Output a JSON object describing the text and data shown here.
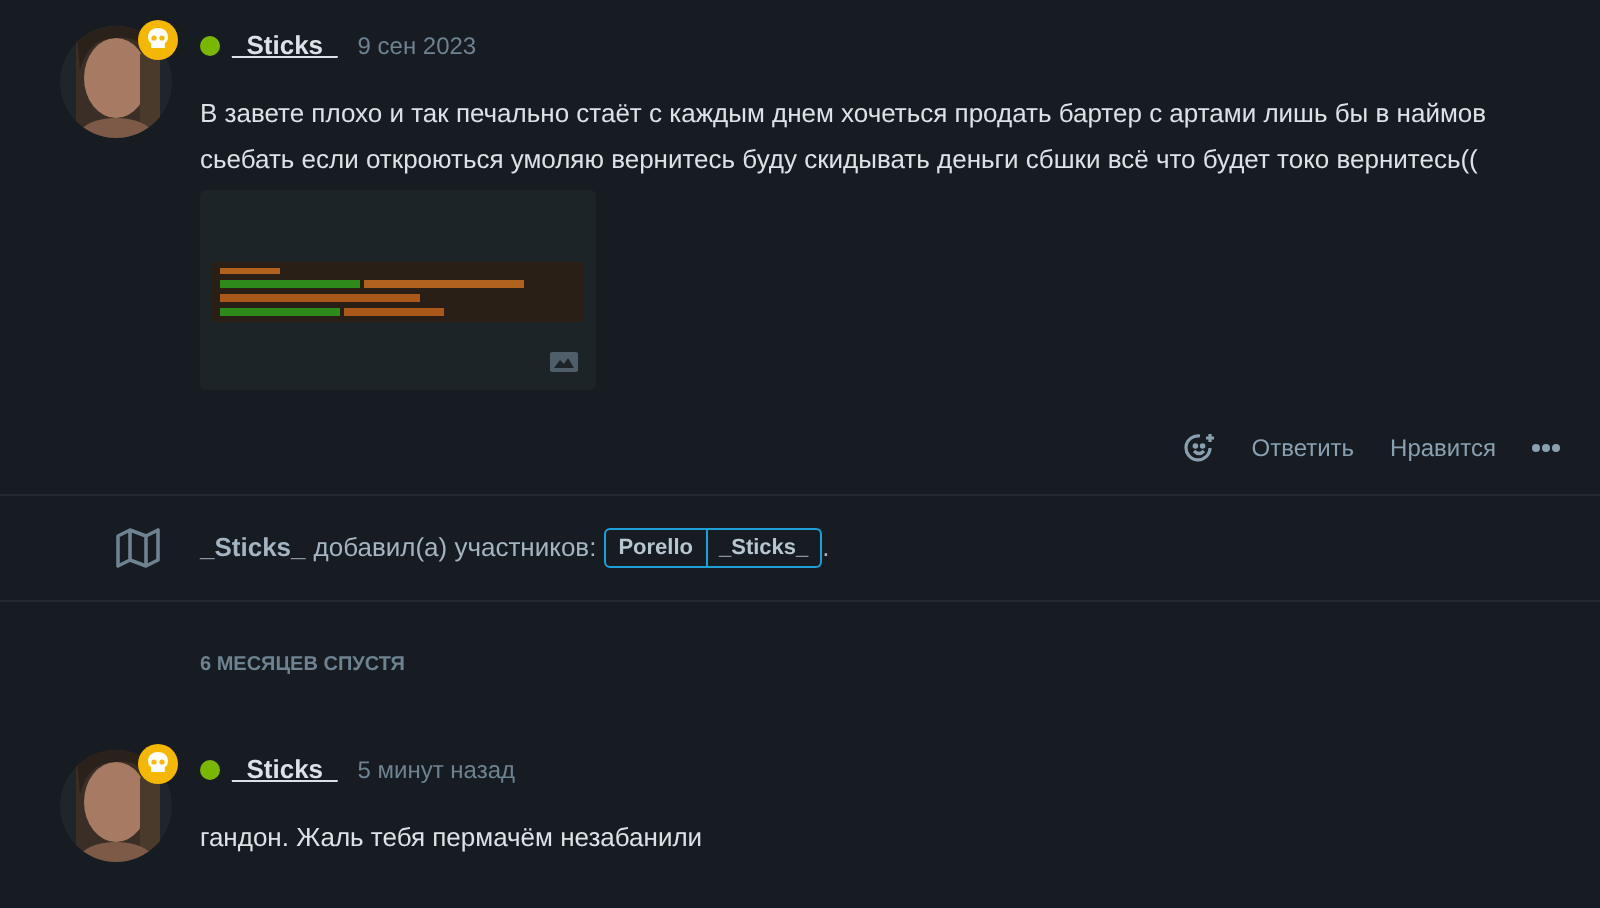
{
  "posts": [
    {
      "author": "_Sticks_",
      "online": true,
      "time": "9 сен 2023",
      "text": "В завете плохо и так печально стаёт с каждым днем хочеться продать бартер с артами лишь бы в наймов сьебать если откроються умоляю вернитесь буду скидывать деньги сбшки всё что будет токо вернитесь((",
      "actions": {
        "reply": "Ответить",
        "like": "Нравится"
      }
    },
    {
      "kind": "event",
      "author": "_Sticks_",
      "text": "добавил(а) участников:",
      "participants": [
        "Porello",
        "_Sticks_"
      ],
      "end": "."
    },
    {
      "kind": "divider",
      "text": "6 МЕСЯЦЕВ СПУСТЯ"
    },
    {
      "author": "_Sticks_",
      "online": true,
      "time": "5 минут назад",
      "text": "гандон. Жаль тебя пермачём незабанили"
    }
  ]
}
